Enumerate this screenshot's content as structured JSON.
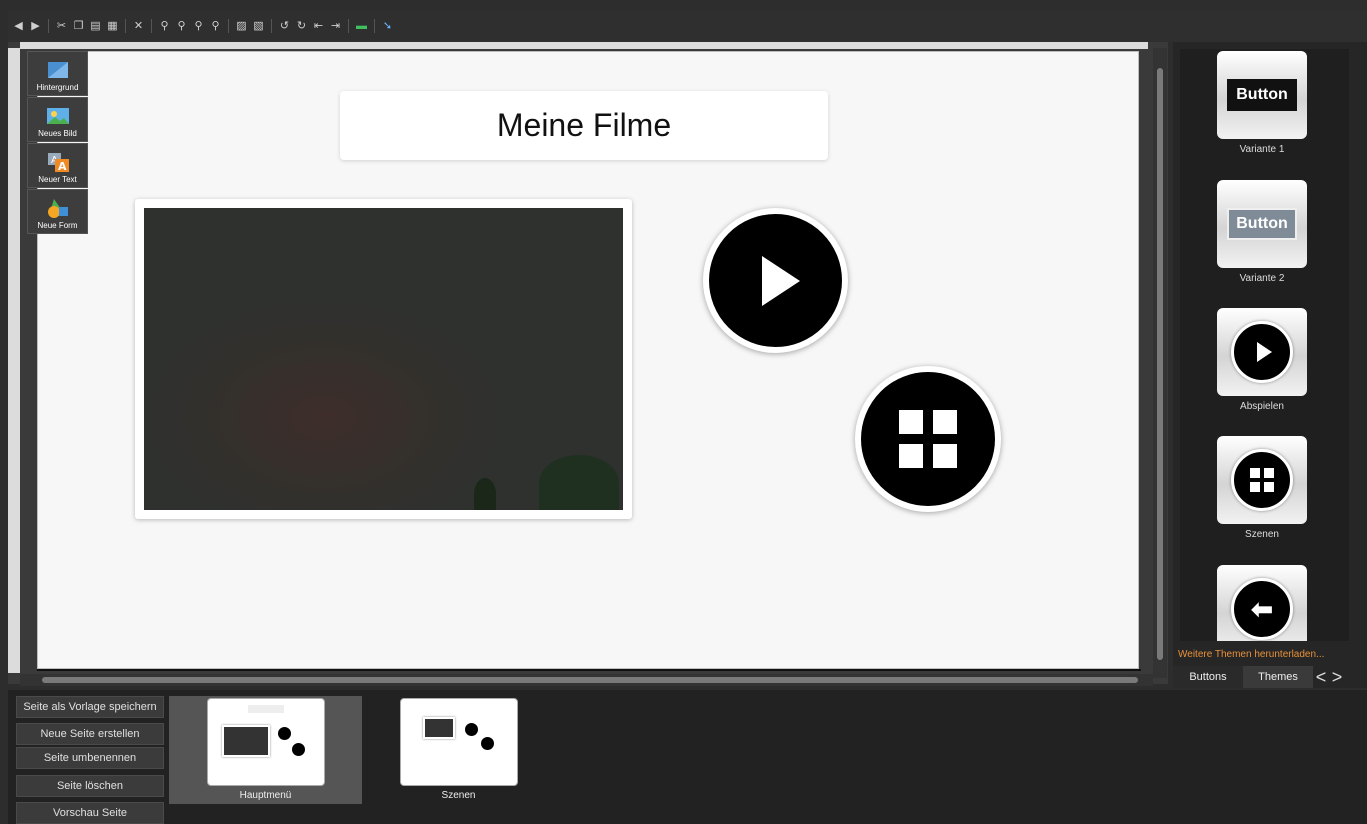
{
  "toolbar": {
    "icons": [
      "back-icon",
      "forward-icon",
      "cut-icon",
      "copy-icon",
      "paste-icon",
      "paste-special-icon",
      "delete-icon",
      "zoom-in-icon",
      "zoom-out-icon",
      "zoom-fit-icon",
      "zoom-reset-icon",
      "bring-front-icon",
      "send-back-icon",
      "rotate-left-icon",
      "rotate-right-icon",
      "align-left-icon",
      "align-right-icon",
      "color-icon",
      "pointer-icon"
    ]
  },
  "tools": [
    {
      "label": "Hintergrund",
      "icon": "background-icon"
    },
    {
      "label": "Neues Bild",
      "icon": "image-icon"
    },
    {
      "label": "Neuer Text",
      "icon": "text-icon"
    },
    {
      "label": "Neue Form",
      "icon": "shape-icon"
    }
  ],
  "canvas": {
    "title": "Meine Filme"
  },
  "gallery": {
    "items": [
      {
        "label": "Variante 1",
        "preview_text": "Button"
      },
      {
        "label": "Variante 2",
        "preview_text": "Button"
      },
      {
        "label": "Abspielen"
      },
      {
        "label": "Szenen"
      },
      {
        "label": ""
      }
    ],
    "more_themes": "Weitere Themen herunterladen...",
    "tabs": [
      "Buttons",
      "Themes"
    ],
    "nav_prev": "<",
    "nav_next": ">"
  },
  "page_actions": [
    "Seite als Vorlage speichern",
    "Neue Seite erstellen",
    "Seite umbenennen",
    "Seite löschen",
    "Vorschau Seite"
  ],
  "pages": [
    {
      "label": "Hauptmenü",
      "selected": true
    },
    {
      "label": "Szenen",
      "selected": false
    }
  ],
  "colors": {
    "accent_orange": "#e8913a",
    "panel_bg": "#262626",
    "canvas_bg": "#f7f7f7"
  }
}
